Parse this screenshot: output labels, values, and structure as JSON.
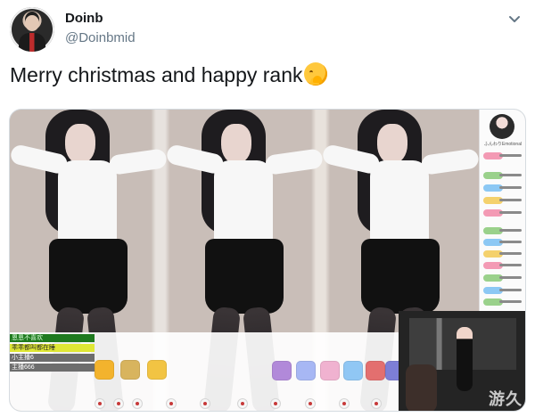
{
  "tweet": {
    "display_name": "Doinb",
    "handle": "@Doinbmid",
    "text": "Merry christmas and happy rank",
    "emoji": "face-with-hand-over-mouth-emoji",
    "menu_icon": "chevron-down-icon"
  },
  "media": {
    "type": "livestream-screenshot",
    "chat_title": "ふんわりEmotional",
    "overlay_lines": [
      "恩恩不喜欢",
      "乖乖都叫都在睡",
      "小主播6",
      "主播666"
    ],
    "gift_items": [
      "",
      "",
      "",
      "",
      "",
      "",
      "",
      "",
      ""
    ],
    "watermark": "游久"
  }
}
